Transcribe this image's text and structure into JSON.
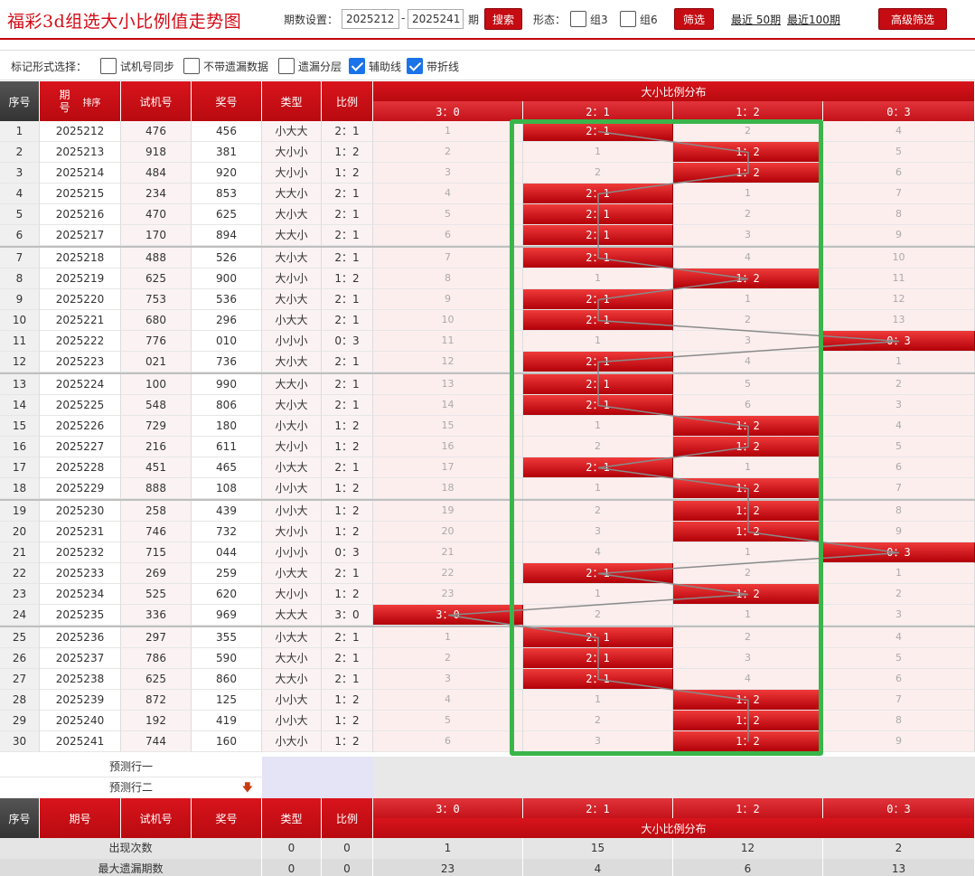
{
  "header": {
    "title": "福彩3d组选大小比例值走势图",
    "period_label": "期数设置：",
    "period_from": "2025212",
    "period_dash": "-",
    "period_to": "2025241",
    "period_unit": "期",
    "search_button": "搜索",
    "form_label": "形态：",
    "group3_label": "组3",
    "group6_label": "组6",
    "filter_button": "筛选",
    "recent50_link": "最近 50期",
    "recent100_link": "最近100期",
    "advanced_button": "高级筛选"
  },
  "options": {
    "label": "标记形式选择：",
    "items": [
      {
        "label": "试机号同步",
        "checked": false
      },
      {
        "label": "不带遗漏数据",
        "checked": false
      },
      {
        "label": "遗漏分层",
        "checked": false
      },
      {
        "label": "辅助线",
        "checked": true
      },
      {
        "label": "带折线",
        "checked": true
      }
    ]
  },
  "table": {
    "headers": {
      "seq": "序号",
      "period": "期号",
      "sort": "排序",
      "test": "试机号",
      "award": "奖号",
      "type": "类型",
      "ratio": "比例",
      "dist_title": "大小比例分布",
      "dist_cols": [
        "3：0",
        "2：1",
        "1：2",
        "0：3"
      ]
    },
    "rows": [
      {
        "seq": "1",
        "period": "2025212",
        "test": "476",
        "award": "456",
        "type": "小大大",
        "ratio": "2：1",
        "dist": [
          "1",
          "2：1",
          "2",
          "4"
        ],
        "hit": 1
      },
      {
        "seq": "2",
        "period": "2025213",
        "test": "918",
        "award": "381",
        "type": "大小小",
        "ratio": "1：2",
        "dist": [
          "2",
          "1",
          "1：2",
          "5"
        ],
        "hit": 2
      },
      {
        "seq": "3",
        "period": "2025214",
        "test": "484",
        "award": "920",
        "type": "大小小",
        "ratio": "1：2",
        "dist": [
          "3",
          "2",
          "1：2",
          "6"
        ],
        "hit": 2
      },
      {
        "seq": "4",
        "period": "2025215",
        "test": "234",
        "award": "853",
        "type": "大大小",
        "ratio": "2：1",
        "dist": [
          "4",
          "2：1",
          "1",
          "7"
        ],
        "hit": 1
      },
      {
        "seq": "5",
        "period": "2025216",
        "test": "470",
        "award": "625",
        "type": "大小大",
        "ratio": "2：1",
        "dist": [
          "5",
          "2：1",
          "2",
          "8"
        ],
        "hit": 1
      },
      {
        "seq": "6",
        "period": "2025217",
        "test": "170",
        "award": "894",
        "type": "大大小",
        "ratio": "2：1",
        "dist": [
          "6",
          "2：1",
          "3",
          "9"
        ],
        "hit": 1
      },
      {
        "seq": "7",
        "period": "2025218",
        "test": "488",
        "award": "526",
        "type": "大小大",
        "ratio": "2：1",
        "dist": [
          "7",
          "2：1",
          "4",
          "10"
        ],
        "hit": 1
      },
      {
        "seq": "8",
        "period": "2025219",
        "test": "625",
        "award": "900",
        "type": "大小小",
        "ratio": "1：2",
        "dist": [
          "8",
          "1",
          "1：2",
          "11"
        ],
        "hit": 2
      },
      {
        "seq": "9",
        "period": "2025220",
        "test": "753",
        "award": "536",
        "type": "大小大",
        "ratio": "2：1",
        "dist": [
          "9",
          "2：1",
          "1",
          "12"
        ],
        "hit": 1
      },
      {
        "seq": "10",
        "period": "2025221",
        "test": "680",
        "award": "296",
        "type": "小大大",
        "ratio": "2：1",
        "dist": [
          "10",
          "2：1",
          "2",
          "13"
        ],
        "hit": 1
      },
      {
        "seq": "11",
        "period": "2025222",
        "test": "776",
        "award": "010",
        "type": "小小小",
        "ratio": "0：3",
        "dist": [
          "11",
          "1",
          "3",
          "0：3"
        ],
        "hit": 3
      },
      {
        "seq": "12",
        "period": "2025223",
        "test": "021",
        "award": "736",
        "type": "大小大",
        "ratio": "2：1",
        "dist": [
          "12",
          "2：1",
          "4",
          "1"
        ],
        "hit": 1
      },
      {
        "seq": "13",
        "period": "2025224",
        "test": "100",
        "award": "990",
        "type": "大大小",
        "ratio": "2：1",
        "dist": [
          "13",
          "2：1",
          "5",
          "2"
        ],
        "hit": 1
      },
      {
        "seq": "14",
        "period": "2025225",
        "test": "548",
        "award": "806",
        "type": "大小大",
        "ratio": "2：1",
        "dist": [
          "14",
          "2：1",
          "6",
          "3"
        ],
        "hit": 1
      },
      {
        "seq": "15",
        "period": "2025226",
        "test": "729",
        "award": "180",
        "type": "小大小",
        "ratio": "1：2",
        "dist": [
          "15",
          "1",
          "1：2",
          "4"
        ],
        "hit": 2
      },
      {
        "seq": "16",
        "period": "2025227",
        "test": "216",
        "award": "611",
        "type": "大小小",
        "ratio": "1：2",
        "dist": [
          "16",
          "2",
          "1：2",
          "5"
        ],
        "hit": 2
      },
      {
        "seq": "17",
        "period": "2025228",
        "test": "451",
        "award": "465",
        "type": "小大大",
        "ratio": "2：1",
        "dist": [
          "17",
          "2：1",
          "1",
          "6"
        ],
        "hit": 1
      },
      {
        "seq": "18",
        "period": "2025229",
        "test": "888",
        "award": "108",
        "type": "小小大",
        "ratio": "1：2",
        "dist": [
          "18",
          "1",
          "1：2",
          "7"
        ],
        "hit": 2
      },
      {
        "seq": "19",
        "period": "2025230",
        "test": "258",
        "award": "439",
        "type": "小小大",
        "ratio": "1：2",
        "dist": [
          "19",
          "2",
          "1：2",
          "8"
        ],
        "hit": 2
      },
      {
        "seq": "20",
        "period": "2025231",
        "test": "746",
        "award": "732",
        "type": "大小小",
        "ratio": "1：2",
        "dist": [
          "20",
          "3",
          "1：2",
          "9"
        ],
        "hit": 2
      },
      {
        "seq": "21",
        "period": "2025232",
        "test": "715",
        "award": "044",
        "type": "小小小",
        "ratio": "0：3",
        "dist": [
          "21",
          "4",
          "1",
          "0：3"
        ],
        "hit": 3
      },
      {
        "seq": "22",
        "period": "2025233",
        "test": "269",
        "award": "259",
        "type": "小大大",
        "ratio": "2：1",
        "dist": [
          "22",
          "2：1",
          "2",
          "1"
        ],
        "hit": 1
      },
      {
        "seq": "23",
        "period": "2025234",
        "test": "525",
        "award": "620",
        "type": "大小小",
        "ratio": "1：2",
        "dist": [
          "23",
          "1",
          "1：2",
          "2"
        ],
        "hit": 2
      },
      {
        "seq": "24",
        "period": "2025235",
        "test": "336",
        "award": "969",
        "type": "大大大",
        "ratio": "3：0",
        "dist": [
          "3：0",
          "2",
          "1",
          "3"
        ],
        "hit": 0
      },
      {
        "seq": "25",
        "period": "2025236",
        "test": "297",
        "award": "355",
        "type": "小大大",
        "ratio": "2：1",
        "dist": [
          "1",
          "2：1",
          "2",
          "4"
        ],
        "hit": 1
      },
      {
        "seq": "26",
        "period": "2025237",
        "test": "786",
        "award": "590",
        "type": "大大小",
        "ratio": "2：1",
        "dist": [
          "2",
          "2：1",
          "3",
          "5"
        ],
        "hit": 1
      },
      {
        "seq": "27",
        "period": "2025238",
        "test": "625",
        "award": "860",
        "type": "大大小",
        "ratio": "2：1",
        "dist": [
          "3",
          "2：1",
          "4",
          "6"
        ],
        "hit": 1
      },
      {
        "seq": "28",
        "period": "2025239",
        "test": "872",
        "award": "125",
        "type": "小小大",
        "ratio": "1：2",
        "dist": [
          "4",
          "1",
          "1：2",
          "7"
        ],
        "hit": 2
      },
      {
        "seq": "29",
        "period": "2025240",
        "test": "192",
        "award": "419",
        "type": "小小大",
        "ratio": "1：2",
        "dist": [
          "5",
          "2",
          "1：2",
          "8"
        ],
        "hit": 2
      },
      {
        "seq": "30",
        "period": "2025241",
        "test": "744",
        "award": "160",
        "type": "小大小",
        "ratio": "1：2",
        "dist": [
          "6",
          "3",
          "1：2",
          "9"
        ],
        "hit": 2
      }
    ],
    "prediction": [
      "预测行一",
      "预测行二"
    ],
    "stats": [
      {
        "label": "出现次数",
        "type": "0",
        "ratio": "0",
        "values": [
          "1",
          "15",
          "12",
          "2"
        ]
      },
      {
        "label": "最大遗漏期数",
        "type": "0",
        "ratio": "0",
        "values": [
          "23",
          "4",
          "6",
          "13"
        ]
      }
    ]
  },
  "colors": {
    "header_red": "#c40c12",
    "hit_red": "#d61a20",
    "highlight_green": "#3ab54a",
    "checkbox_blue": "#1a73e8"
  }
}
